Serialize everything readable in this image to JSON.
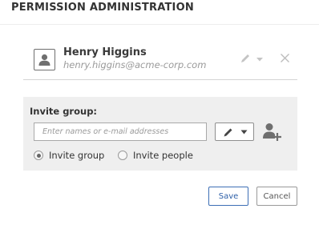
{
  "header": {
    "title": "PERMISSION ADMINISTRATION"
  },
  "user": {
    "name": "Henry Higgins",
    "email": "henry.higgins@acme-corp.com",
    "avatar_icon": "person-icon",
    "edit_icon": "pencil-icon",
    "dropdown_icon": "caret-down-icon",
    "remove_icon": "close-icon"
  },
  "invite": {
    "title": "Invite group:",
    "input_placeholder": "Enter names or e-mail addresses",
    "input_value": "",
    "permission_icon": "pencil-icon",
    "add_icon": "add-person-icon",
    "options": [
      {
        "label": "Invite group",
        "selected": true
      },
      {
        "label": "Invite people",
        "selected": false
      }
    ]
  },
  "actions": {
    "save_label": "Save",
    "cancel_label": "Cancel"
  },
  "colors": {
    "panel_bg": "#efefef",
    "save_border": "#3d6fb5",
    "icon_gray": "#6f6f6f",
    "faint_icon": "#c4c4c4"
  }
}
